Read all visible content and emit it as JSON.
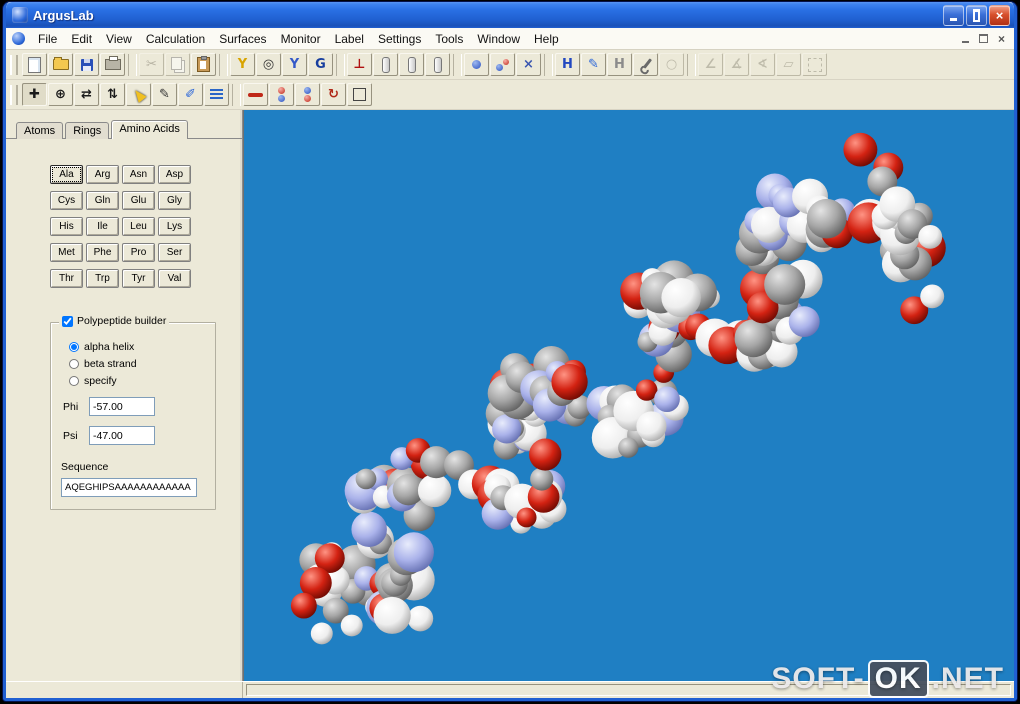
{
  "window": {
    "title": "ArgusLab"
  },
  "icons": {
    "close": "×",
    "mdi_close": "×"
  },
  "menubar": {
    "items": [
      "File",
      "Edit",
      "View",
      "Calculation",
      "Surfaces",
      "Monitor",
      "Label",
      "Settings",
      "Tools",
      "Window",
      "Help"
    ]
  },
  "toolbars": {
    "row1": [
      {
        "name": "new-file",
        "kind": "shape",
        "shape": "page"
      },
      {
        "name": "open-file",
        "kind": "shape",
        "shape": "folder"
      },
      {
        "name": "save",
        "kind": "shape",
        "shape": "floppy"
      },
      {
        "name": "print",
        "kind": "shape",
        "shape": "printer"
      },
      {
        "kind": "sep"
      },
      {
        "name": "cut",
        "kind": "glyph",
        "glyph": "✂",
        "color": "#8a8676",
        "disabled": true
      },
      {
        "name": "copy",
        "kind": "shape",
        "shape": "copy",
        "disabled": true
      },
      {
        "name": "paste",
        "kind": "shape",
        "shape": "paste"
      },
      {
        "kind": "sep"
      },
      {
        "name": "clean-geometry",
        "kind": "glyph",
        "glyph": "Y",
        "color": "#d8a400"
      },
      {
        "name": "toggle-hydrogens",
        "kind": "glyph",
        "glyph": "◎",
        "color": "#333333"
      },
      {
        "name": "add-fragment",
        "kind": "glyph",
        "glyph": "Y",
        "color": "#3358c8"
      },
      {
        "name": "optimize-geometry",
        "kind": "glyph",
        "glyph": "G",
        "color": "#173e9e"
      },
      {
        "kind": "sep"
      },
      {
        "name": "align-axis",
        "kind": "glyph",
        "glyph": "⊥",
        "color": "#b01010"
      },
      {
        "name": "capsule-a",
        "kind": "shape",
        "shape": "pill"
      },
      {
        "name": "capsule-b",
        "kind": "shape",
        "shape": "pill"
      },
      {
        "name": "capsule-c",
        "kind": "shape",
        "shape": "pill"
      },
      {
        "kind": "sep"
      },
      {
        "name": "single-atom",
        "kind": "shape",
        "shape": "dot"
      },
      {
        "name": "atom-pair",
        "kind": "shape",
        "shape": "dots2"
      },
      {
        "name": "delete-atoms",
        "kind": "glyph",
        "glyph": "×",
        "color": "#3a56b0"
      },
      {
        "kind": "sep"
      },
      {
        "name": "show-hydrogens",
        "kind": "glyph",
        "glyph": "H",
        "color": "#2248c0"
      },
      {
        "name": "edit-label",
        "kind": "glyph",
        "glyph": "✎",
        "color": "#2b66d8"
      },
      {
        "name": "gray-hydrogens",
        "kind": "glyph",
        "glyph": "H",
        "color": "#8b8b8b"
      },
      {
        "name": "wrench-tool",
        "kind": "shape",
        "shape": "wrench"
      },
      {
        "name": "ring-tool",
        "kind": "glyph",
        "glyph": "○",
        "color": "#9a9686",
        "disabled": true
      },
      {
        "kind": "sep"
      },
      {
        "name": "measure-distance",
        "kind": "glyph",
        "glyph": "∠",
        "color": "#9a9686",
        "disabled": true
      },
      {
        "name": "measure-angle",
        "kind": "glyph",
        "glyph": "∡",
        "color": "#9a9686",
        "disabled": true
      },
      {
        "name": "measure-dihedral",
        "kind": "glyph",
        "glyph": "∢",
        "color": "#9a9686",
        "disabled": true
      },
      {
        "name": "measure-plane",
        "kind": "glyph",
        "glyph": "▱",
        "color": "#9a9686",
        "disabled": true
      },
      {
        "name": "selection-mode",
        "kind": "shape",
        "shape": "dashed",
        "disabled": true
      }
    ],
    "row2": [
      {
        "name": "translate-tool",
        "kind": "glyph",
        "glyph": "✚",
        "color": "#1a1a1a",
        "active": true
      },
      {
        "name": "rotate-tool",
        "kind": "glyph",
        "glyph": "⊕",
        "color": "#1a1a1a"
      },
      {
        "name": "scale-tool",
        "kind": "glyph",
        "glyph": "⇄",
        "color": "#1a1a1a"
      },
      {
        "name": "rotate-z-tool",
        "kind": "glyph",
        "glyph": "⇅",
        "color": "#1a1a1a"
      },
      {
        "name": "select-tool",
        "kind": "shape",
        "shape": "cursor"
      },
      {
        "name": "draw-tool",
        "kind": "glyph",
        "glyph": "✎",
        "color": "#333333"
      },
      {
        "name": "annotate-tool",
        "kind": "glyph",
        "glyph": "✐",
        "color": "#2b66d8"
      },
      {
        "name": "tree-view",
        "kind": "shape",
        "shape": "list"
      },
      {
        "kind": "sep"
      },
      {
        "name": "bond-tool",
        "kind": "shape",
        "shape": "bondred"
      },
      {
        "name": "bond-order-up",
        "kind": "shape",
        "shape": "dotsrb"
      },
      {
        "name": "bond-order-down",
        "kind": "shape",
        "shape": "dotsbr"
      },
      {
        "name": "rotate-bond-tool",
        "kind": "glyph",
        "glyph": "↻",
        "color": "#b02818"
      },
      {
        "name": "plane-tool",
        "kind": "shape",
        "shape": "square"
      }
    ]
  },
  "panel": {
    "tabs": [
      {
        "label": "Atoms",
        "active": false
      },
      {
        "label": "Rings",
        "active": false
      },
      {
        "label": "Amino Acids",
        "active": true
      }
    ],
    "amino_acids": [
      "Ala",
      "Arg",
      "Asn",
      "Asp",
      "Cys",
      "Gln",
      "Glu",
      "Gly",
      "His",
      "Ile",
      "Leu",
      "Lys",
      "Met",
      "Phe",
      "Pro",
      "Ser",
      "Thr",
      "Trp",
      "Tyr",
      "Val"
    ],
    "builder": {
      "label": "Polypeptide builder",
      "checked": true,
      "options": [
        {
          "label": "alpha helix",
          "selected": true
        },
        {
          "label": "beta strand",
          "selected": false
        },
        {
          "label": "specify",
          "selected": false
        }
      ],
      "phi_label": "Phi",
      "phi": "-57.00",
      "psi_label": "Psi",
      "psi": "-47.00",
      "sequence_label": "Sequence",
      "sequence": "AQEGHIPSAAAAAAAAAAAA"
    }
  },
  "viewport": {
    "background": "#1f7fc3",
    "atom_colors": {
      "carbon": "#a6a6a6",
      "hydrogen": "#f0f0f0",
      "oxygen": "#d32212",
      "nitrogen": "#aab2ea"
    }
  },
  "watermark": {
    "prefix": "SOFT-",
    "boxed": "OK",
    "suffix": ".NET"
  }
}
